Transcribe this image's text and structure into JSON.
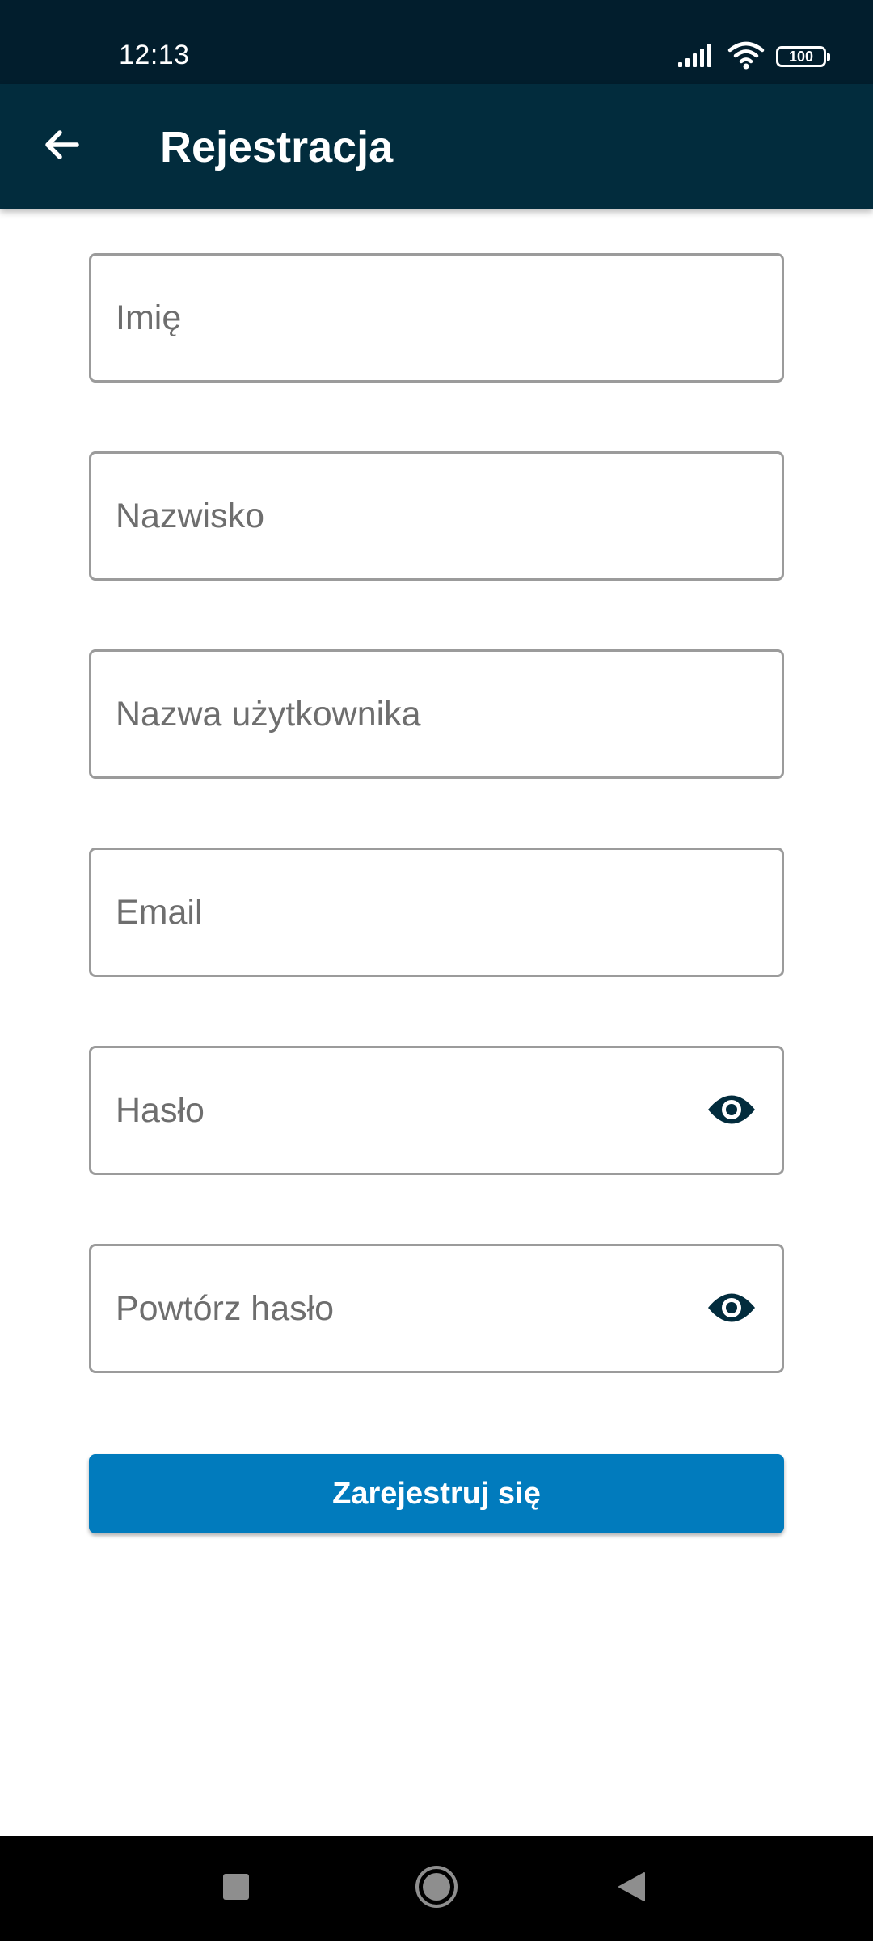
{
  "status_bar": {
    "time": "12:13",
    "battery": "100",
    "icons": [
      "signal-icon",
      "wifi-icon",
      "battery-icon"
    ]
  },
  "app_bar": {
    "back_icon": "arrow-left-icon",
    "title": "Rejestracja"
  },
  "form": {
    "first_name": {
      "placeholder": "Imię",
      "value": ""
    },
    "last_name": {
      "placeholder": "Nazwisko",
      "value": ""
    },
    "username": {
      "placeholder": "Nazwa użytkownika",
      "value": ""
    },
    "email": {
      "placeholder": "Email",
      "value": ""
    },
    "password": {
      "placeholder": "Hasło",
      "value": "",
      "toggle_icon": "eye-icon"
    },
    "password_repeat": {
      "placeholder": "Powtórz hasło",
      "value": "",
      "toggle_icon": "eye-icon"
    },
    "submit_label": "Zarejestruj się"
  },
  "nav_bar": {
    "icons": [
      "recents-square-icon",
      "home-circle-icon",
      "back-triangle-icon"
    ]
  },
  "colors": {
    "status_bar": "#021e2d",
    "app_bar": "#022c3d",
    "primary_button": "#017bbd",
    "field_border": "#9b9b9b",
    "placeholder": "#6e6e6e",
    "eye_icon": "#022c3d"
  }
}
